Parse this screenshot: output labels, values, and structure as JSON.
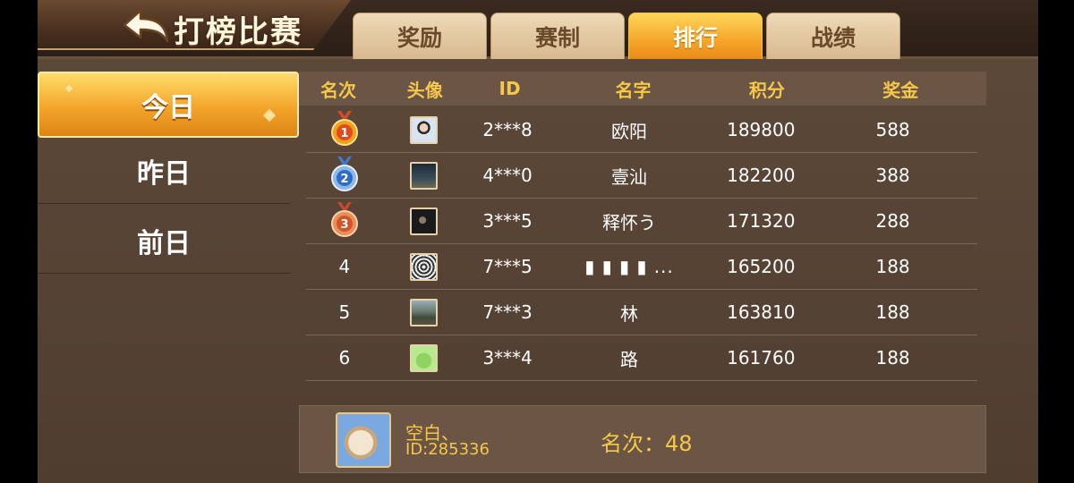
{
  "header": {
    "title": "打榜比赛",
    "tabs": [
      {
        "label": "奖励",
        "active": false
      },
      {
        "label": "赛制",
        "active": false
      },
      {
        "label": "排行",
        "active": true
      },
      {
        "label": "战绩",
        "active": false
      }
    ]
  },
  "sidebar": {
    "items": [
      {
        "label": "今日",
        "active": true
      },
      {
        "label": "昨日",
        "active": false
      },
      {
        "label": "前日",
        "active": false
      }
    ]
  },
  "table": {
    "headers": [
      "名次",
      "头像",
      "ID",
      "名字",
      "积分",
      "奖金"
    ],
    "rows": [
      {
        "rank": "1",
        "medal": "gold-medal-icon",
        "avatar": "avatar-person-icon",
        "id": "2***8",
        "name": "欧阳",
        "score": "189800",
        "prize": "588"
      },
      {
        "rank": "2",
        "medal": "silver-medal-icon",
        "avatar": "avatar-night-icon",
        "id": "4***0",
        "name": "壹汕",
        "score": "182200",
        "prize": "388"
      },
      {
        "rank": "3",
        "medal": "bronze-medal-icon",
        "avatar": "avatar-dark-icon",
        "id": "3***5",
        "name": "释怀う",
        "score": "171320",
        "prize": "288"
      },
      {
        "rank": "4",
        "medal": "",
        "avatar": "avatar-pattern-icon",
        "id": "7***5",
        "name": "▮ ▮ ▮ ▮ ...",
        "score": "165200",
        "prize": "188"
      },
      {
        "rank": "5",
        "medal": "",
        "avatar": "avatar-landscape-icon",
        "id": "7***3",
        "name": "林",
        "score": "163810",
        "prize": "188"
      },
      {
        "rank": "6",
        "medal": "",
        "avatar": "avatar-frog-icon",
        "id": "3***4",
        "name": "路",
        "score": "161760",
        "prize": "188"
      }
    ]
  },
  "me": {
    "name": "空白、",
    "id": "ID:285336",
    "rank_label": "名次：48"
  },
  "colors": {
    "accent": "#f5c84a",
    "active_tab": "#f6a62a",
    "tab_inactive": "#e2c79f",
    "panel": "#6b5545",
    "background": "#574436"
  }
}
